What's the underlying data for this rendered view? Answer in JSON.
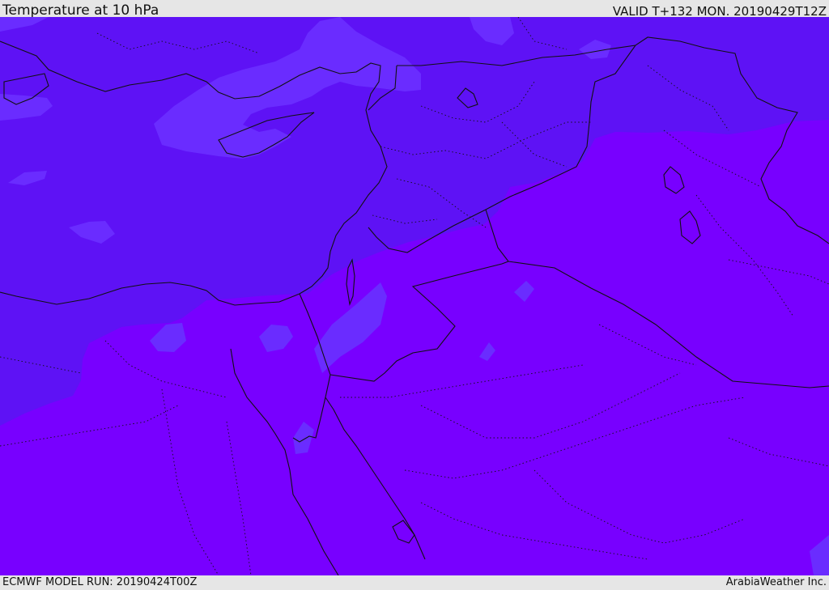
{
  "header": {
    "title": "Temperature at 10 hPa",
    "valid": "VALID T+132 MON. 20190429T12Z"
  },
  "footer": {
    "model_run": "ECMWF MODEL RUN: 20190424T00Z",
    "credit": "ArabiaWeather Inc."
  },
  "map": {
    "colors": {
      "field_warm": "#7800ff",
      "field_cool": "#5e12f5",
      "field_coolest": "#6a2cff",
      "boundary": "#111111"
    }
  }
}
